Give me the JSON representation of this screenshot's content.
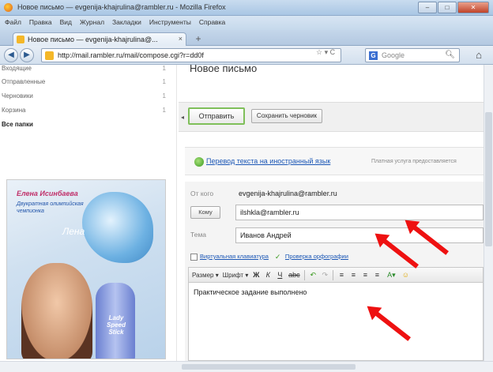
{
  "window": {
    "title": "Новое письмо — evgenija-khajrulina@rambler.ru - Mozilla Firefox",
    "buttons": {
      "minimize": "–",
      "maximize": "□",
      "close": "✕"
    }
  },
  "menu": {
    "items": [
      "Файл",
      "Правка",
      "Вид",
      "Журнал",
      "Закладки",
      "Инструменты",
      "Справка"
    ]
  },
  "tabs": [
    {
      "label": "Новое письмо — evgenija-khajrulina@...",
      "close": "×"
    }
  ],
  "new_tab": "+",
  "nav": {
    "back": "◀",
    "forward": "▶",
    "url": "http://mail.rambler.ru/mail/compose.cgi?r=dd0f",
    "url_controls": "☆ ▾ C",
    "search_engine": "G",
    "search_placeholder": "Google",
    "search_icon": "search-icon",
    "home_icon": "home-icon",
    "home": "⌂"
  },
  "sidebar": {
    "folders": [
      {
        "name": "Входящие",
        "count": "1"
      },
      {
        "name": "Отправленные",
        "count": "1"
      },
      {
        "name": "Черновики",
        "count": "1"
      },
      {
        "name": "Корзина",
        "count": "1"
      },
      {
        "name": "Все папки",
        "count": ""
      }
    ],
    "ad": {
      "headline": "Елена Исинбаева",
      "tagline": "Двукратная олимпийская чемпионка",
      "signature": "Лена",
      "brand": "Lady Speed Stick"
    }
  },
  "compose": {
    "page_title": "Новое письмо",
    "send_label": "Отправить",
    "save_draft_label": "Сохранить черновик",
    "translate_link": "Перевод текста на иностранный язык",
    "translate_note": "Платная услуга предоставляется",
    "from_label": "От кого",
    "from_value": "evgenija-khajrulina@rambler.ru",
    "to_button": "Кому",
    "to_value": "ilshkla@rambler.ru",
    "subject_label": "Тема",
    "subject_value": "Иванов Андрей",
    "virtual_keyboard_link": "Виртуальная клавиатура",
    "spellcheck_link": "Проверка орфографии",
    "editor_size": "Размер",
    "editor_font": "Шрифт",
    "editor_dropdown": "▾",
    "format_buttons": [
      "Ж",
      "К",
      "Ч",
      "abc"
    ],
    "history_buttons": [
      "↶",
      "↷"
    ],
    "align_buttons": [
      "≡",
      "≡",
      "≡",
      "≡"
    ],
    "color_buttons": [
      "A▾",
      "☺"
    ],
    "body_text": "Практическое задание выполнено"
  },
  "annotation": {
    "arrow_color": "#ee1111"
  }
}
